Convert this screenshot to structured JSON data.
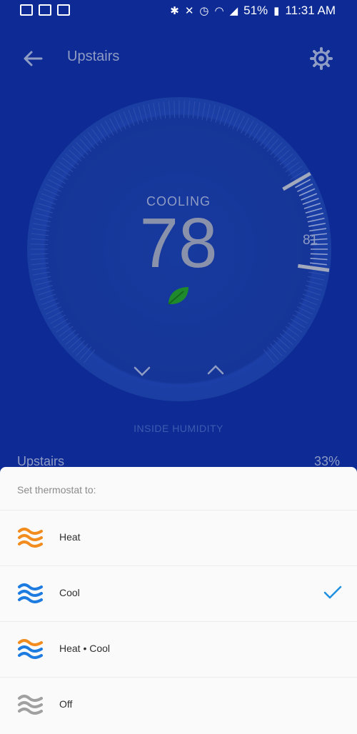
{
  "status_bar": {
    "battery": "51%",
    "time": "11:31 AM"
  },
  "app_bar": {
    "title": "Upstairs"
  },
  "dial": {
    "mode_label": "COOLING",
    "current_temp": "78",
    "setpoint": "81"
  },
  "humidity": {
    "label": "INSIDE HUMIDITY",
    "room_name": "Upstairs",
    "value": "33%"
  },
  "sheet": {
    "header": "Set thermostat to:",
    "options": [
      {
        "label": "Heat",
        "icon": "heat-icon",
        "selected": false
      },
      {
        "label": "Cool",
        "icon": "cool-icon",
        "selected": true
      },
      {
        "label": "Heat • Cool",
        "icon": "heat-cool-icon",
        "selected": false
      },
      {
        "label": "Off",
        "icon": "off-icon",
        "selected": false
      }
    ]
  },
  "colors": {
    "background": "#0d2a95",
    "heat": "#f28c1e",
    "cool": "#1e7be0",
    "off": "#a0a0a0",
    "check": "#1e90e0",
    "leaf": "#1f8a2b"
  }
}
